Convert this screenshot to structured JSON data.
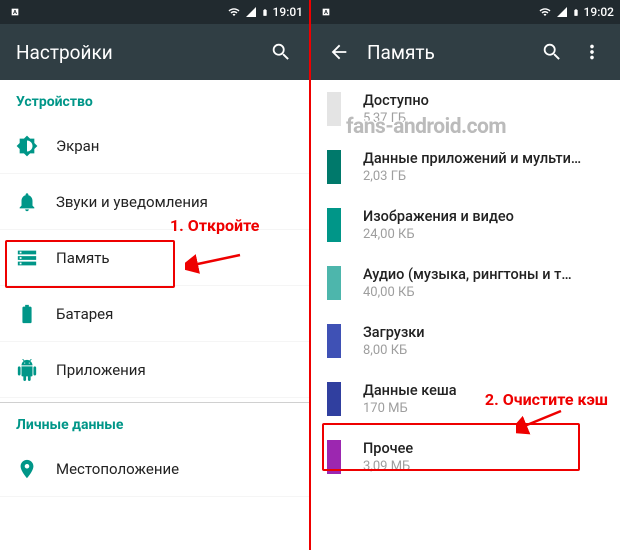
{
  "left": {
    "status": {
      "time": "19:01"
    },
    "toolbar": {
      "title": "Настройки"
    },
    "section_device": "Устройство",
    "items": [
      {
        "label": "Экран"
      },
      {
        "label": "Звуки и уведомления"
      },
      {
        "label": "Память"
      },
      {
        "label": "Батарея"
      },
      {
        "label": "Приложения"
      }
    ],
    "section_personal": "Личные данные",
    "personal_items": [
      {
        "label": "Местоположение"
      }
    ]
  },
  "right": {
    "status": {
      "time": "19:02"
    },
    "toolbar": {
      "title": "Память"
    },
    "items": [
      {
        "title": "Доступно",
        "sub": "5,37 ГБ",
        "color": "#e4e4e4"
      },
      {
        "title": "Данные приложений и мульти…",
        "sub": "2,03 ГБ",
        "color": "#00796b"
      },
      {
        "title": "Изображения и видео",
        "sub": "24,00 КБ",
        "color": "#009688"
      },
      {
        "title": "Аудио (музыка, рингтоны и т…",
        "sub": "40,00 КБ",
        "color": "#4db6ac"
      },
      {
        "title": "Загрузки",
        "sub": "8,00 КБ",
        "color": "#3f51b5"
      },
      {
        "title": "Данные кеша",
        "sub": "170 МБ",
        "color": "#303f9f"
      },
      {
        "title": "Прочее",
        "sub": "3,09 МБ",
        "color": "#9c27b0"
      }
    ]
  },
  "annotations": {
    "step1": "1. Откройте",
    "step2": "2. Очистите кэш"
  },
  "watermark": "fans-android.com"
}
